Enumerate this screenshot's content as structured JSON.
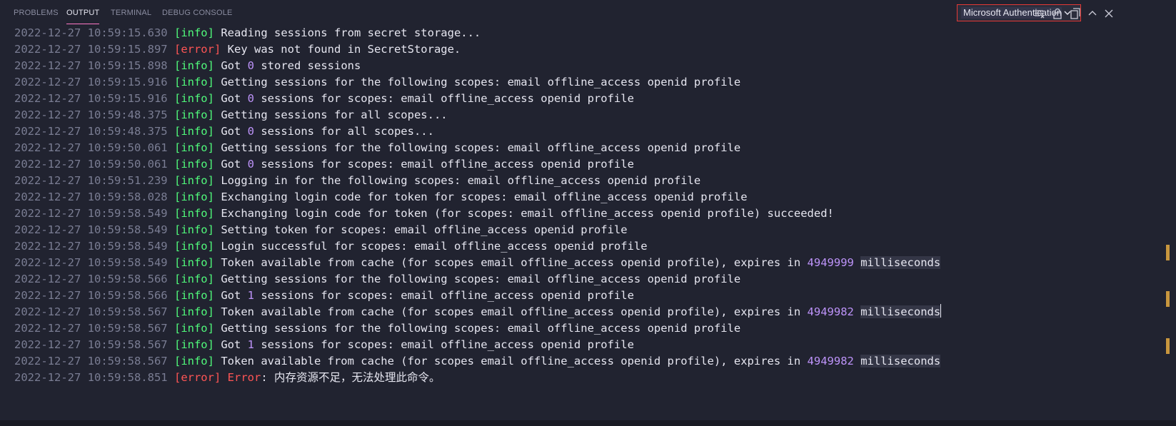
{
  "tabs": {
    "problems": "PROBLEMS",
    "output": "OUTPUT",
    "terminal": "TERMINAL",
    "debug_console": "DEBUG CONSOLE"
  },
  "channel_select": {
    "value": "Microsoft Authentication"
  },
  "toolbar_icons": [
    "clear-output-icon",
    "lock-scroll-icon",
    "open-in-editor-icon",
    "maximize-panel-icon",
    "close-panel-icon"
  ],
  "colors": {
    "info": "#50fa7b",
    "error": "#ff5555",
    "number": "#bd93f9",
    "timestamp": "#7a7d93",
    "highlight_border": "#e53935"
  },
  "log": [
    {
      "ts": "2022-12-27 10:59:15.630",
      "level": "info",
      "parts": [
        {
          "t": "Reading sessions from secret storage..."
        }
      ]
    },
    {
      "ts": "2022-12-27 10:59:15.897",
      "level": "error",
      "parts": [
        {
          "t": "Key was not found in SecretStorage."
        }
      ]
    },
    {
      "ts": "2022-12-27 10:59:15.898",
      "level": "info",
      "parts": [
        {
          "t": "Got "
        },
        {
          "t": "0",
          "c": "num"
        },
        {
          "t": " stored sessions"
        }
      ]
    },
    {
      "ts": "2022-12-27 10:59:15.916",
      "level": "info",
      "parts": [
        {
          "t": "Getting sessions for the following scopes: email offline_access openid profile"
        }
      ]
    },
    {
      "ts": "2022-12-27 10:59:15.916",
      "level": "info",
      "parts": [
        {
          "t": "Got "
        },
        {
          "t": "0",
          "c": "num"
        },
        {
          "t": " sessions for scopes: email offline_access openid profile"
        }
      ]
    },
    {
      "ts": "2022-12-27 10:59:48.375",
      "level": "info",
      "parts": [
        {
          "t": "Getting sessions for all scopes..."
        }
      ]
    },
    {
      "ts": "2022-12-27 10:59:48.375",
      "level": "info",
      "parts": [
        {
          "t": "Got "
        },
        {
          "t": "0",
          "c": "num"
        },
        {
          "t": " sessions for all scopes..."
        }
      ]
    },
    {
      "ts": "2022-12-27 10:59:50.061",
      "level": "info",
      "parts": [
        {
          "t": "Getting sessions for the following scopes: email offline_access openid profile"
        }
      ]
    },
    {
      "ts": "2022-12-27 10:59:50.061",
      "level": "info",
      "parts": [
        {
          "t": "Got "
        },
        {
          "t": "0",
          "c": "num"
        },
        {
          "t": " sessions for scopes: email offline_access openid profile"
        }
      ]
    },
    {
      "ts": "2022-12-27 10:59:51.239",
      "level": "info",
      "parts": [
        {
          "t": "Logging in for the following scopes: email offline_access openid profile"
        }
      ]
    },
    {
      "ts": "2022-12-27 10:59:58.028",
      "level": "info",
      "parts": [
        {
          "t": "Exchanging login code for token for scopes: email offline_access openid profile"
        }
      ]
    },
    {
      "ts": "2022-12-27 10:59:58.549",
      "level": "info",
      "parts": [
        {
          "t": "Exchanging login code for token (for scopes: email offline_access openid profile) succeeded!"
        }
      ]
    },
    {
      "ts": "2022-12-27 10:59:58.549",
      "level": "info",
      "parts": [
        {
          "t": "Setting token for scopes: email offline_access openid profile"
        }
      ]
    },
    {
      "ts": "2022-12-27 10:59:58.549",
      "level": "info",
      "parts": [
        {
          "t": "Login successful for scopes: email offline_access openid profile"
        }
      ]
    },
    {
      "ts": "2022-12-27 10:59:58.549",
      "level": "info",
      "parts": [
        {
          "t": "Token available from cache (for scopes email offline_access openid profile), expires in "
        },
        {
          "t": "4949999",
          "c": "num"
        },
        {
          "t": " "
        },
        {
          "t": "milliseconds",
          "c": "hl"
        }
      ]
    },
    {
      "ts": "2022-12-27 10:59:58.566",
      "level": "info",
      "parts": [
        {
          "t": "Getting sessions for the following scopes: email offline_access openid profile"
        }
      ]
    },
    {
      "ts": "2022-12-27 10:59:58.566",
      "level": "info",
      "parts": [
        {
          "t": "Got "
        },
        {
          "t": "1",
          "c": "num"
        },
        {
          "t": " sessions for scopes: email offline_access openid profile"
        }
      ]
    },
    {
      "ts": "2022-12-27 10:59:58.567",
      "level": "info",
      "parts": [
        {
          "t": "Token available from cache (for scopes email offline_access openid profile), expires in "
        },
        {
          "t": "4949982",
          "c": "num"
        },
        {
          "t": " "
        },
        {
          "t": "milliseconds",
          "c": "hl"
        },
        {
          "t": "",
          "c": "cursor"
        }
      ]
    },
    {
      "ts": "2022-12-27 10:59:58.567",
      "level": "info",
      "parts": [
        {
          "t": "Getting sessions for the following scopes: email offline_access openid profile"
        }
      ]
    },
    {
      "ts": "2022-12-27 10:59:58.567",
      "level": "info",
      "parts": [
        {
          "t": "Got "
        },
        {
          "t": "1",
          "c": "num"
        },
        {
          "t": " sessions for scopes: email offline_access openid profile"
        }
      ]
    },
    {
      "ts": "2022-12-27 10:59:58.567",
      "level": "info",
      "parts": [
        {
          "t": "Token available from cache (for scopes email offline_access openid profile), expires in "
        },
        {
          "t": "4949982",
          "c": "num"
        },
        {
          "t": " "
        },
        {
          "t": "milliseconds",
          "c": "hl"
        }
      ]
    },
    {
      "ts": "2022-12-27 10:59:58.851",
      "level": "error",
      "parts": [
        {
          "t": "Error",
          "c": "err-word"
        },
        {
          "t": ": 内存资源不足，无法处理此命令。"
        }
      ]
    }
  ],
  "level_labels": {
    "info": "[info]",
    "error": "[error]"
  }
}
